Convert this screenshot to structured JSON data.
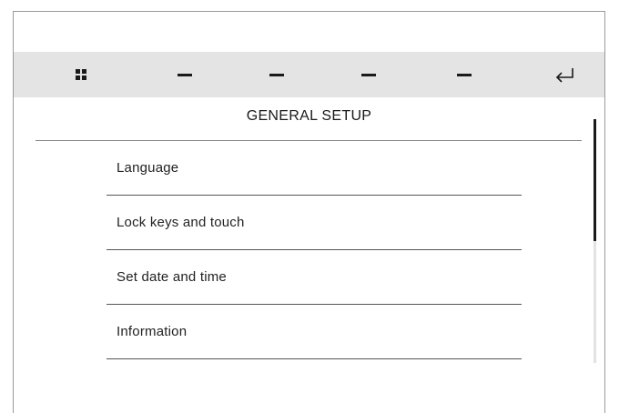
{
  "toolbar": {
    "buttons": [
      {
        "icon": "grid-icon"
      },
      {
        "icon": "dash-icon"
      },
      {
        "icon": "dash-icon"
      },
      {
        "icon": "dash-icon"
      },
      {
        "icon": "dash-icon"
      },
      {
        "icon": "return-arrow-icon"
      }
    ]
  },
  "screen": {
    "title": "GENERAL SETUP"
  },
  "menu": {
    "items": [
      {
        "label": "Language"
      },
      {
        "label": "Lock keys and touch"
      },
      {
        "label": "Set date and time"
      },
      {
        "label": "Information"
      }
    ]
  },
  "scrollbar": {
    "position_fraction": 0.0,
    "visible_fraction": 0.5
  }
}
